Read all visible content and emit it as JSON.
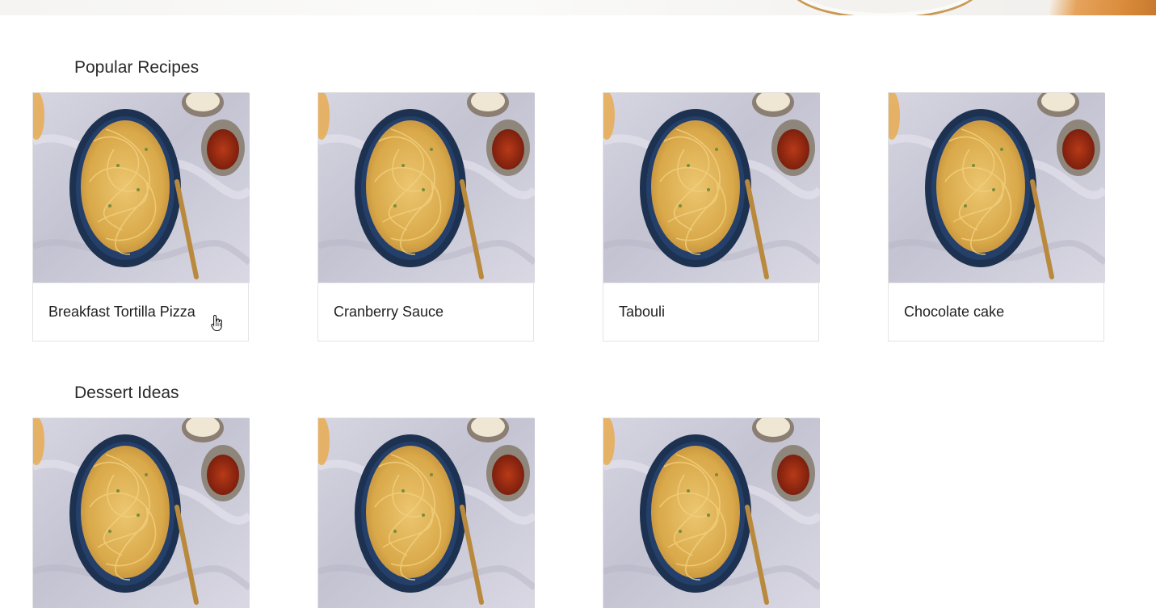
{
  "sections": [
    {
      "title": "Popular Recipes",
      "cards": [
        {
          "name": "Breakfast Tortilla Pizza"
        },
        {
          "name": "Cranberry Sauce"
        },
        {
          "name": "Tabouli"
        },
        {
          "name": "Chocolate cake"
        }
      ]
    },
    {
      "title": "Dessert Ideas",
      "cards": [
        {},
        {},
        {}
      ]
    }
  ],
  "image": {
    "subject": "spaghetti-plate"
  },
  "colors": {
    "marble": "#c9c8d6",
    "plate": "#1f3557",
    "pasta": "#e0b357",
    "chili": "#9b2a12",
    "spoon": "#b98a3e"
  }
}
